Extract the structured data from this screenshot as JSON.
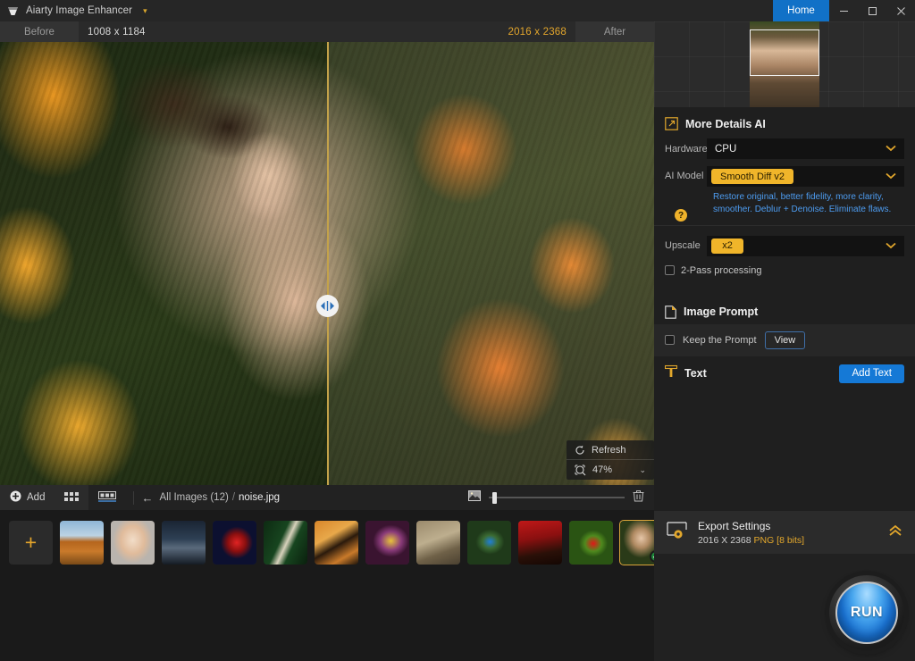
{
  "titlebar": {
    "app_name": "Aiarty Image Enhancer",
    "caret": "▾",
    "home_label": "Home",
    "minimize": "minimize-icon",
    "maximize": "maximize-icon",
    "close": "close-icon"
  },
  "compare": {
    "before_label": "Before",
    "before_size": "1008 x 1184",
    "after_size": "2016 x 2368",
    "after_label": "After",
    "view_modes": [
      "split-view",
      "side-by-side-view"
    ],
    "active_view_mode": "split-view"
  },
  "viewer": {
    "refresh_label": "Refresh",
    "zoom_level": "47%",
    "zoom_caret": "⌄"
  },
  "filmstrip_toolbar": {
    "add_label": "Add",
    "grid_view": "grid-view-icon",
    "single_view": "single-view-icon",
    "back_arrow": "←",
    "breadcrumb_all": "All Images (12)",
    "breadcrumb_sep": "/",
    "breadcrumb_file": "noise.jpg",
    "thumb_size_icon": "image-size-icon",
    "delete_icon": "trash-icon"
  },
  "filmstrip": {
    "add_tile": "+",
    "items": [
      {
        "name": "florence-cathedral",
        "selected": false
      },
      {
        "name": "blonde-portrait",
        "selected": false
      },
      {
        "name": "mountain-range",
        "selected": false
      },
      {
        "name": "red-rose",
        "selected": false
      },
      {
        "name": "green-snake",
        "selected": false
      },
      {
        "name": "tiger",
        "selected": false
      },
      {
        "name": "yellow-bird",
        "selected": false
      },
      {
        "name": "moth-camouflage",
        "selected": false
      },
      {
        "name": "blue-bird",
        "selected": false
      },
      {
        "name": "hummingbird-red-flower",
        "selected": false
      },
      {
        "name": "red-poppy",
        "selected": false
      },
      {
        "name": "noise-portrait",
        "selected": true
      }
    ],
    "selected_badge": "check-icon"
  },
  "panel": {
    "navigator": {
      "icon": "navigator-thumbnail",
      "viewport": "viewport-rect"
    },
    "more_details": {
      "title": "More Details AI",
      "icon": "expand-ai-icon",
      "hardware_label": "Hardware",
      "hardware_value": "CPU",
      "ai_model_label": "AI Model",
      "ai_model_value": "Smooth Diff v2",
      "ai_model_help": "?",
      "ai_model_desc": "Restore original, better fidelity, more clarity, smoother. Deblur + Denoise. Eliminate flaws.",
      "upscale_label": "Upscale",
      "upscale_value": "x2",
      "two_pass_label": "2-Pass processing",
      "two_pass_checked": false,
      "caret": "⌄"
    },
    "image_prompt": {
      "title": "Image Prompt",
      "icon": "document-icon",
      "keep_prompt_label": "Keep the Prompt",
      "keep_prompt_checked": false,
      "view_label": "View"
    },
    "text": {
      "title": "Text",
      "icon": "text-tool-icon",
      "add_text_label": "Add Text"
    },
    "export": {
      "icon": "export-settings-icon",
      "title": "Export Settings",
      "dimensions": "2016 X 2368",
      "format": "PNG",
      "bits": "[8 bits]",
      "collapse_caret": "«"
    },
    "run_label": "RUN"
  },
  "colors": {
    "accent_orange": "#e8a62c",
    "accent_blue": "#1579d6",
    "desc_blue": "#4d9cf0",
    "panel_bg": "#1f1f1f",
    "titlebar_bg": "#262626"
  }
}
